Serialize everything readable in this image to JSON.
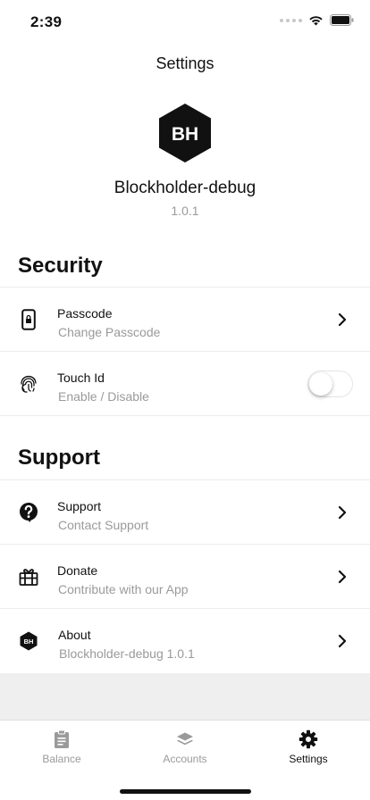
{
  "status_bar": {
    "time": "2:39"
  },
  "nav": {
    "title": "Settings"
  },
  "app": {
    "logo_text": "BH",
    "name": "Blockholder-debug",
    "version": "1.0.1"
  },
  "sections": {
    "security": {
      "title": "Security",
      "items": [
        {
          "title": "Passcode",
          "subtitle": "Change Passcode",
          "icon": "phone-lock-icon"
        },
        {
          "title": "Touch Id",
          "subtitle": "Enable / Disable",
          "icon": "fingerprint-icon",
          "toggle_on": false
        }
      ]
    },
    "support": {
      "title": "Support",
      "items": [
        {
          "title": "Support",
          "subtitle": "Contact Support",
          "icon": "help-icon"
        },
        {
          "title": "Donate",
          "subtitle": "Contribute with our App",
          "icon": "gift-icon"
        },
        {
          "title": "About",
          "subtitle": "Blockholder-debug 1.0.1",
          "icon": "bh-logo-icon",
          "logo_text": "BH"
        }
      ]
    }
  },
  "tabs": [
    {
      "label": "Balance",
      "icon": "clipboard-icon",
      "active": false
    },
    {
      "label": "Accounts",
      "icon": "layers-icon",
      "active": false
    },
    {
      "label": "Settings",
      "icon": "gear-icon",
      "active": true
    }
  ],
  "colors": {
    "text": "#111111",
    "secondary": "#9a9a9a",
    "divider": "#ececec",
    "inactive_tab": "#9a9a9a",
    "footer_gray": "#efefef"
  }
}
